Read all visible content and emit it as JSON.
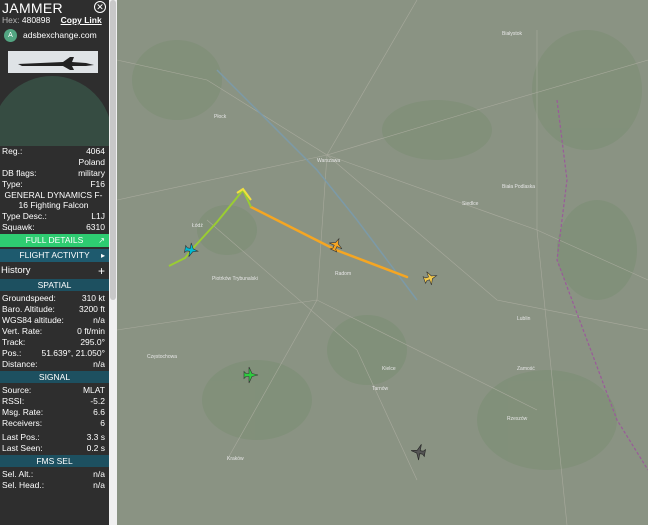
{
  "panel": {
    "title": "JAMMER",
    "close_glyph": "✕",
    "hex_label": "Hex:",
    "hex_value": "480898",
    "copy_link": "Copy Link",
    "source_logo": "A",
    "source_name": "adsbexchange.com",
    "details": [
      {
        "k": "Reg.:",
        "v": "4064"
      },
      {
        "k": "",
        "v": "Poland"
      },
      {
        "k": "DB flags:",
        "v": "military"
      },
      {
        "k": "Type:",
        "v": "F16"
      }
    ],
    "type_full": "GENERAL DYNAMICS F-16 Fighting Falcon",
    "details2": [
      {
        "k": "Type Desc.:",
        "v": "L1J"
      },
      {
        "k": "Squawk:",
        "v": "6310"
      }
    ],
    "full_details_label": "FULL DETAILS",
    "flight_activity_label": "FLIGHT ACTIVITY",
    "history_label": "History",
    "spatial_header": "SPATIAL",
    "spatial": [
      {
        "k": "Groundspeed:",
        "v": "310 kt"
      },
      {
        "k": "Baro. Altitude:",
        "v": "3200 ft"
      },
      {
        "k": "WGS84 altitude:",
        "v": "n/a"
      },
      {
        "k": "Vert. Rate:",
        "v": "0 ft/min"
      },
      {
        "k": "Track:",
        "v": "295.0°"
      },
      {
        "k": "Pos.:",
        "v": "51.639°, 21.050°"
      },
      {
        "k": "Distance:",
        "v": "n/a"
      }
    ],
    "signal_header": "SIGNAL",
    "signal": [
      {
        "k": "Source:",
        "v": "MLAT"
      },
      {
        "k": "RSSI:",
        "v": "-5.2"
      },
      {
        "k": "Msg. Rate:",
        "v": "6.6"
      },
      {
        "k": "Receivers:",
        "v": "6"
      }
    ],
    "signal2": [
      {
        "k": "Last Pos.:",
        "v": "3.3 s"
      },
      {
        "k": "Last Seen:",
        "v": "0.2 s"
      }
    ],
    "fms_header": "FMS SEL",
    "fms": [
      {
        "k": "Sel. Alt.:",
        "v": "n/a"
      },
      {
        "k": "Sel. Head.:",
        "v": "n/a"
      }
    ]
  },
  "map": {
    "cities": [
      "Białystok",
      "Płock",
      "Warszawa",
      "Łódź",
      "Radom",
      "Kielce",
      "Częstochowa",
      "Kraków",
      "Lublin",
      "Tarnów",
      "Rzeszów",
      "Siedlce",
      "Piotrków Trybunalski",
      "Zamość",
      "Biała Podlaska"
    ],
    "colors": {
      "track_orange": "#f5a623",
      "track_green": "#9acd32",
      "selected_aircraft": "#f5a623",
      "aircraft_cyan": "#00bcd4",
      "aircraft_green": "#2ecc40",
      "aircraft_gray": "#555555"
    },
    "aircraft_icons": [
      "selected-aircraft-icon",
      "aircraft-icon-yellow",
      "aircraft-icon-cyan",
      "aircraft-icon-green",
      "aircraft-icon-gray"
    ]
  }
}
